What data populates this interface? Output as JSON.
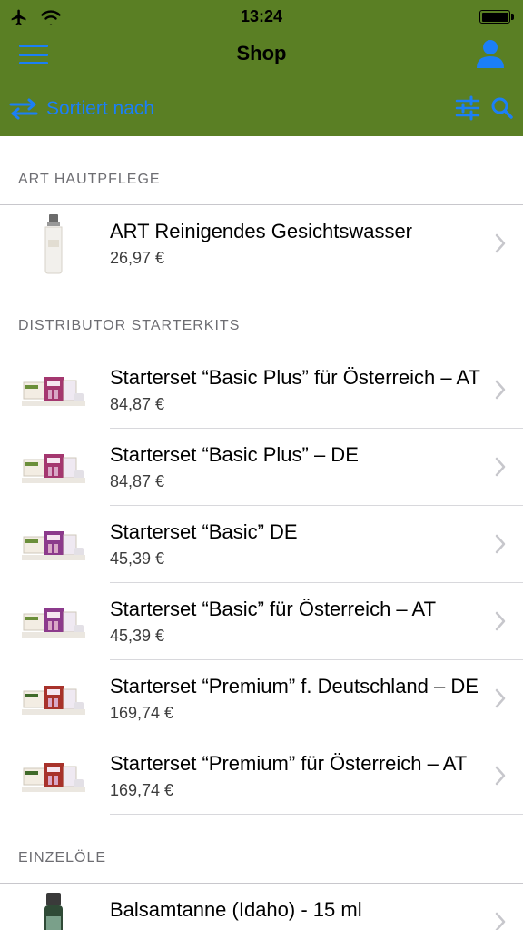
{
  "status_bar": {
    "time": "13:24",
    "icons": [
      "airplane-icon",
      "wifi-icon",
      "battery-icon"
    ]
  },
  "nav": {
    "title": "Shop",
    "menu_icon": "hamburger-menu-icon",
    "profile_icon": "user-profile-icon"
  },
  "toolbar": {
    "sort_label": "Sortiert nach",
    "sort_icon": "sort-arrows-icon",
    "filter_icon": "filter-sliders-icon",
    "search_icon": "search-icon"
  },
  "colors": {
    "header_bg": "#5a7f24",
    "accent": "#1b7ff7",
    "section_text": "#6d6d72"
  },
  "sections": [
    {
      "title": "ART HAUTPFLEGE",
      "items": [
        {
          "name": "ART Reinigendes Gesichtswasser",
          "price": "26,97 €",
          "image": "bottle"
        }
      ]
    },
    {
      "title": "DISTRIBUTOR STARTERKITS",
      "items": [
        {
          "name": "Starterset “Basic Plus” für Österreich – AT",
          "price": "84,87 €",
          "image": "kit-plus"
        },
        {
          "name": "Starterset “Basic Plus” – DE",
          "price": "84,87 €",
          "image": "kit-plus"
        },
        {
          "name": "Starterset “Basic” DE",
          "price": "45,39 €",
          "image": "kit-basic"
        },
        {
          "name": "Starterset “Basic” für Österreich – AT",
          "price": "45,39 €",
          "image": "kit-basic"
        },
        {
          "name": "Starterset “Premium” f. Deutschland – DE",
          "price": "169,74 €",
          "image": "kit-premium"
        },
        {
          "name": "Starterset “Premium” für Österreich – AT",
          "price": "169,74 €",
          "image": "kit-premium"
        }
      ]
    },
    {
      "title": "EINZELÖLE",
      "items": [
        {
          "name": "Balsamtanne (Idaho) - 15 ml",
          "price": "",
          "image": "oil"
        }
      ]
    }
  ]
}
